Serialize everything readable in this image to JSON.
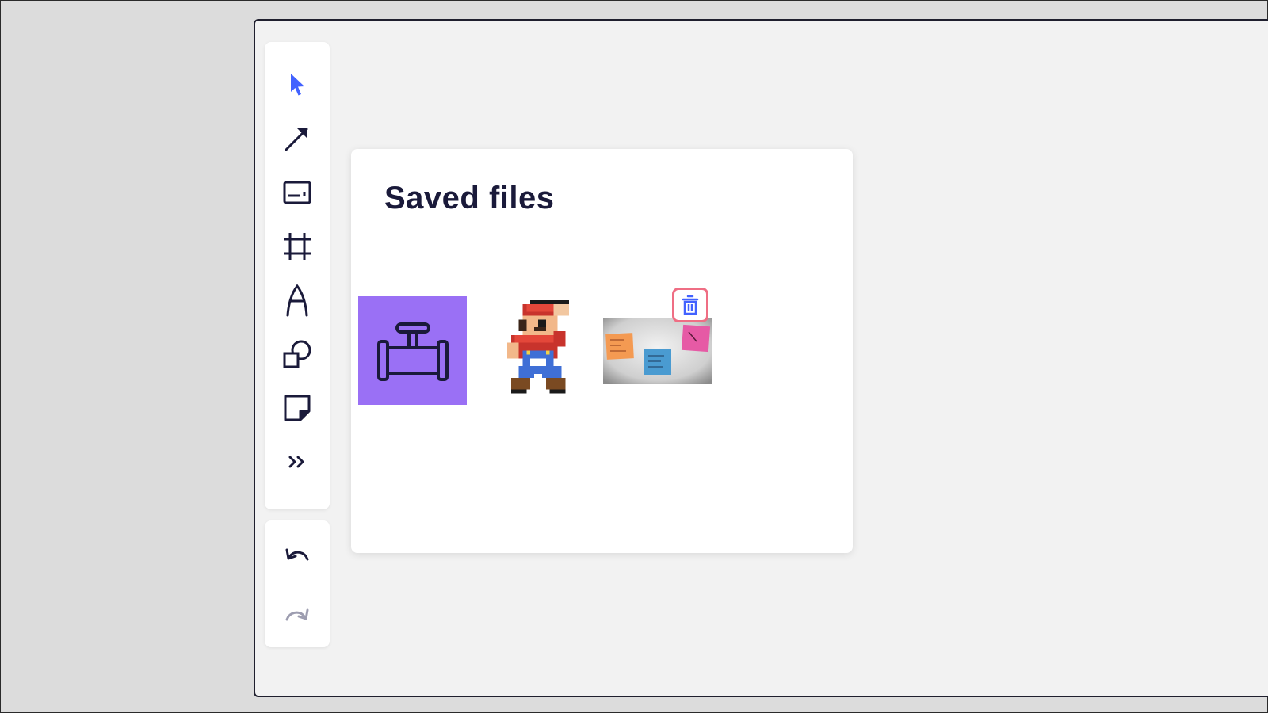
{
  "panel": {
    "title": "Saved files"
  },
  "toolbar": {
    "tools": [
      {
        "name": "select",
        "icon": "cursor-arrow-icon",
        "active": true
      },
      {
        "name": "arrow",
        "icon": "arrow-line-icon"
      },
      {
        "name": "text",
        "icon": "text-box-icon"
      },
      {
        "name": "frame",
        "icon": "frame-icon"
      },
      {
        "name": "pen",
        "icon": "pen-icon"
      },
      {
        "name": "shapes",
        "icon": "shapes-icon"
      },
      {
        "name": "sticky-note",
        "icon": "sticky-note-icon"
      },
      {
        "name": "more",
        "icon": "chevrons-right-icon"
      }
    ],
    "history": [
      {
        "name": "undo",
        "icon": "undo-icon"
      },
      {
        "name": "redo",
        "icon": "redo-icon",
        "disabled": true
      }
    ]
  },
  "files": [
    {
      "name": "pipe-icon-file",
      "background": "#9a70f5"
    },
    {
      "name": "pixel-sprite-file"
    },
    {
      "name": "sticky-notes-photo-file"
    }
  ],
  "colors": {
    "accent": "#4262ff",
    "ink": "#1a1a3a",
    "delete_border": "#ef6e84",
    "thumb_purple": "#9a70f5"
  }
}
